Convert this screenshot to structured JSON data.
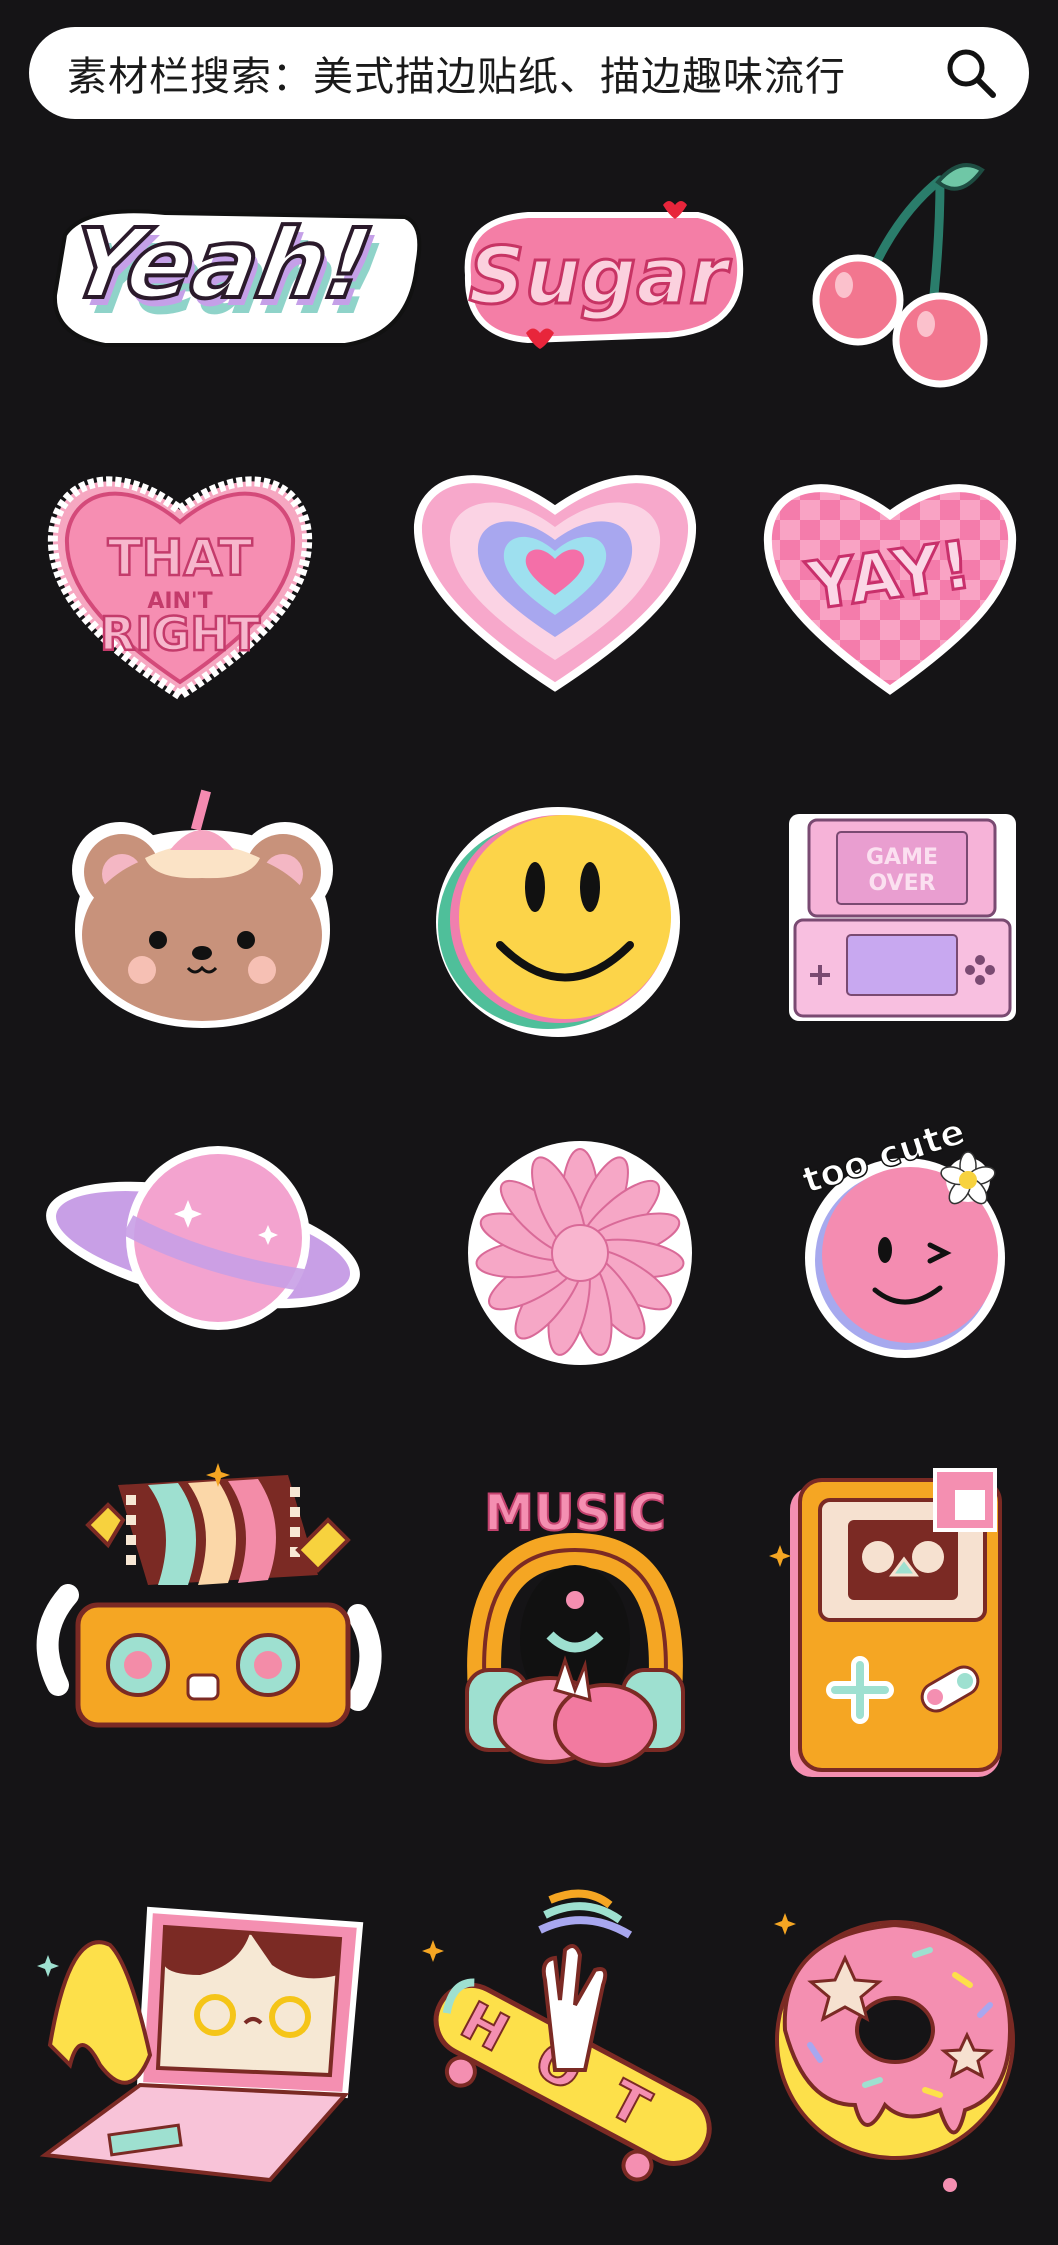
{
  "search": {
    "text": "素材栏搜索：美式描边贴纸、描边趣味流行",
    "icon": "search-icon"
  },
  "stickers": [
    {
      "name": "yeah-sticker",
      "text": "Yeah!"
    },
    {
      "name": "sugar-sticker",
      "text": "Sugar"
    },
    {
      "name": "cherry-sticker"
    },
    {
      "name": "that-aint-right-heart-sticker",
      "line1": "THAT",
      "line2": "AIN'T",
      "line3": "RIGHT"
    },
    {
      "name": "rainbow-heart-sticker"
    },
    {
      "name": "yay-heart-sticker",
      "text": "YAY!"
    },
    {
      "name": "bear-cake-sticker"
    },
    {
      "name": "smiley-face-sticker"
    },
    {
      "name": "game-console-sticker",
      "line1": "GAME",
      "line2": "OVER"
    },
    {
      "name": "planet-sticker"
    },
    {
      "name": "daisy-flower-sticker"
    },
    {
      "name": "too-cute-wink-sticker",
      "text": "too cute"
    },
    {
      "name": "film-camera-character-sticker"
    },
    {
      "name": "music-headphones-sticker",
      "text": "MUSIC"
    },
    {
      "name": "gameboy-sticker"
    },
    {
      "name": "laptop-character-sticker"
    },
    {
      "name": "hot-skateboard-sticker",
      "text": "HOT"
    },
    {
      "name": "donut-sticker"
    }
  ],
  "colors": {
    "background": "#151416",
    "pink": "#f28cb4",
    "hot_pink": "#e94a7f",
    "lilac": "#c9a2e8",
    "yellow": "#fde04a",
    "orange": "#f5a623"
  }
}
